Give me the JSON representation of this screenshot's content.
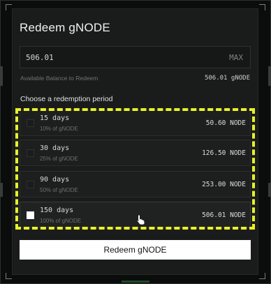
{
  "modal": {
    "title": "Redeem gNODE",
    "amount_input": {
      "value": "506.01",
      "max_label": "MAX"
    },
    "balance": {
      "label": "Available Balance to Redeem",
      "value": "506.01 gNODE"
    },
    "period_label": "Choose a redemption period",
    "options": [
      {
        "days": "15 days",
        "percent": "10% of gNODE",
        "amount": "50.60 NODE",
        "selected": false
      },
      {
        "days": "30 days",
        "percent": "25% of gNODE",
        "amount": "126.50 NODE",
        "selected": false
      },
      {
        "days": "90 days",
        "percent": "50% of gNODE",
        "amount": "253.00 NODE",
        "selected": false
      },
      {
        "days": "150 days",
        "percent": "100% of gNODE",
        "amount": "506.01 NODE",
        "selected": true
      }
    ],
    "submit_label": "Redeem gNODE"
  },
  "colors": {
    "highlight": "#e8f228",
    "background": "#0b0c0c",
    "modal": "#1a1c1c",
    "button": "#ffffff"
  },
  "icons": {
    "cursor": "hand-pointer-icon"
  }
}
